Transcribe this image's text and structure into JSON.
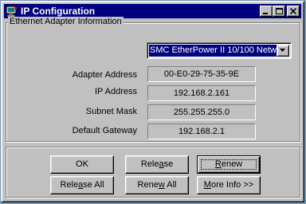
{
  "window": {
    "title": "IP Configuration"
  },
  "adapter_group": {
    "legend": "Ethernet  Adapter Information",
    "selected_adapter": "SMC EtherPower II 10/100 Netw"
  },
  "fields": [
    {
      "label": "Adapter Address",
      "value": "00-E0-29-75-35-9E"
    },
    {
      "label": "IP Address",
      "value": "192.168.2.161"
    },
    {
      "label": "Subnet Mask",
      "value": "255.255.255.0"
    },
    {
      "label": "Default Gateway",
      "value": "192.168.2.1"
    }
  ],
  "buttons": {
    "ok": "OK",
    "release_pre": "Rele",
    "release_ul": "a",
    "release_post": "se",
    "renew_pre": "",
    "renew_ul": "R",
    "renew_post": "enew",
    "release_all_pre": "Rele",
    "release_all_ul": "a",
    "release_all_post": "se All",
    "renew_all_pre": "Rene",
    "renew_all_ul": "w",
    "renew_all_post": " All",
    "more_info_pre": "",
    "more_info_ul": "M",
    "more_info_post": "ore Info >>"
  },
  "icons": {
    "app": "network-computer-icon",
    "minimize": "minimize-icon",
    "maximize": "maximize-icon",
    "close": "close-icon",
    "dropdown": "dropdown-arrow-icon"
  },
  "colors": {
    "titlebar": "#000080",
    "face": "#c0c0c0",
    "selection": "#000080"
  }
}
